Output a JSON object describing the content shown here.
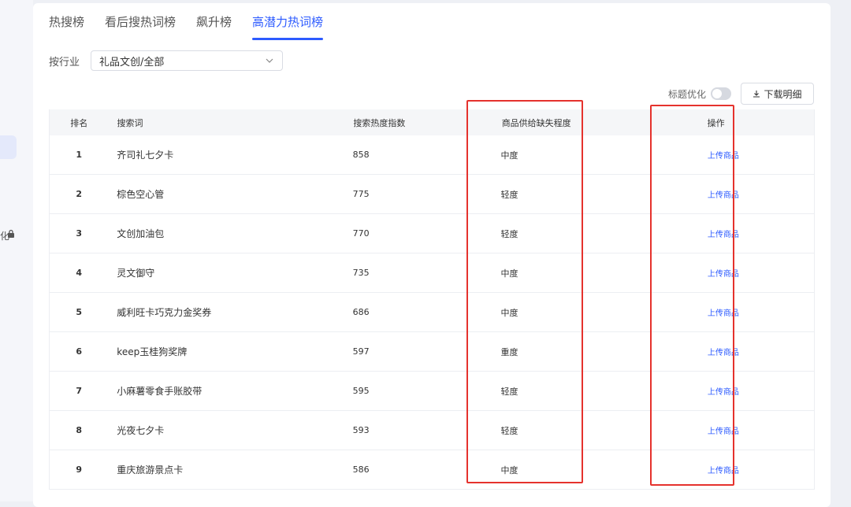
{
  "sidebar": {
    "truncated_text": "化"
  },
  "tabs": [
    {
      "label": "热搜榜",
      "active": false
    },
    {
      "label": "看后搜热词榜",
      "active": false
    },
    {
      "label": "飙升榜",
      "active": false
    },
    {
      "label": "高潜力热词榜",
      "active": true
    }
  ],
  "filter": {
    "industry_label": "按行业",
    "industry_value": "礼品文创/全部"
  },
  "toolbar": {
    "title_optimize_label": "标题优化",
    "download_label": "下载明细"
  },
  "table": {
    "headers": {
      "rank": "排名",
      "term": "搜索词",
      "heat": "搜索热度指数",
      "gap": "商品供给缺失程度",
      "op": "操作"
    },
    "rows": [
      {
        "rank": "1",
        "term": "齐司礼七夕卡",
        "heat": "858",
        "gap": "中度",
        "op": "上传商品"
      },
      {
        "rank": "2",
        "term": "棕色空心管",
        "heat": "775",
        "gap": "轻度",
        "op": "上传商品"
      },
      {
        "rank": "3",
        "term": "文创加油包",
        "heat": "770",
        "gap": "轻度",
        "op": "上传商品"
      },
      {
        "rank": "4",
        "term": "灵文御守",
        "heat": "735",
        "gap": "中度",
        "op": "上传商品"
      },
      {
        "rank": "5",
        "term": "威利旺卡巧克力金奖券",
        "heat": "686",
        "gap": "中度",
        "op": "上传商品"
      },
      {
        "rank": "6",
        "term": "keep玉桂狗奖牌",
        "heat": "597",
        "gap": "重度",
        "op": "上传商品"
      },
      {
        "rank": "7",
        "term": "小麻薯零食手账胶带",
        "heat": "595",
        "gap": "轻度",
        "op": "上传商品"
      },
      {
        "rank": "8",
        "term": "光夜七夕卡",
        "heat": "593",
        "gap": "轻度",
        "op": "上传商品"
      },
      {
        "rank": "9",
        "term": "重庆旅游景点卡",
        "heat": "586",
        "gap": "中度",
        "op": "上传商品"
      }
    ]
  },
  "colors": {
    "accent": "#2d5bff",
    "highlight_box": "#e5322d"
  }
}
